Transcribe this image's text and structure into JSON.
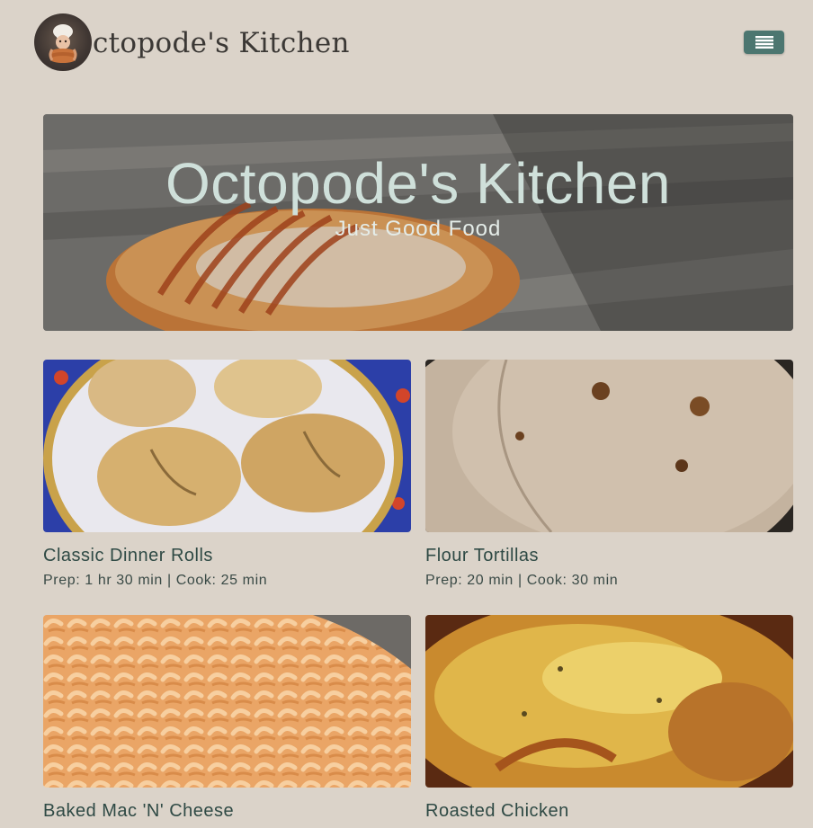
{
  "header": {
    "brand": "ctopode's Kitchen",
    "logo_icon": "octopus-chef-logo-icon",
    "menu_icon": "hamburger-menu-icon"
  },
  "hero": {
    "title": "Octopode's Kitchen",
    "subtitle": "Just Good Food"
  },
  "recipes": [
    {
      "title": "Classic Dinner Rolls",
      "meta": "Prep: 1 hr 30 min | Cook: 25 min"
    },
    {
      "title": "Flour Tortillas",
      "meta": "Prep: 20 min | Cook: 30 min"
    },
    {
      "title": "Baked Mac 'N' Cheese",
      "meta": ""
    },
    {
      "title": "Roasted Chicken",
      "meta": ""
    }
  ],
  "colors": {
    "background": "#dbd3c9",
    "accent": "#4c7670",
    "title_text": "#2f4a45"
  }
}
